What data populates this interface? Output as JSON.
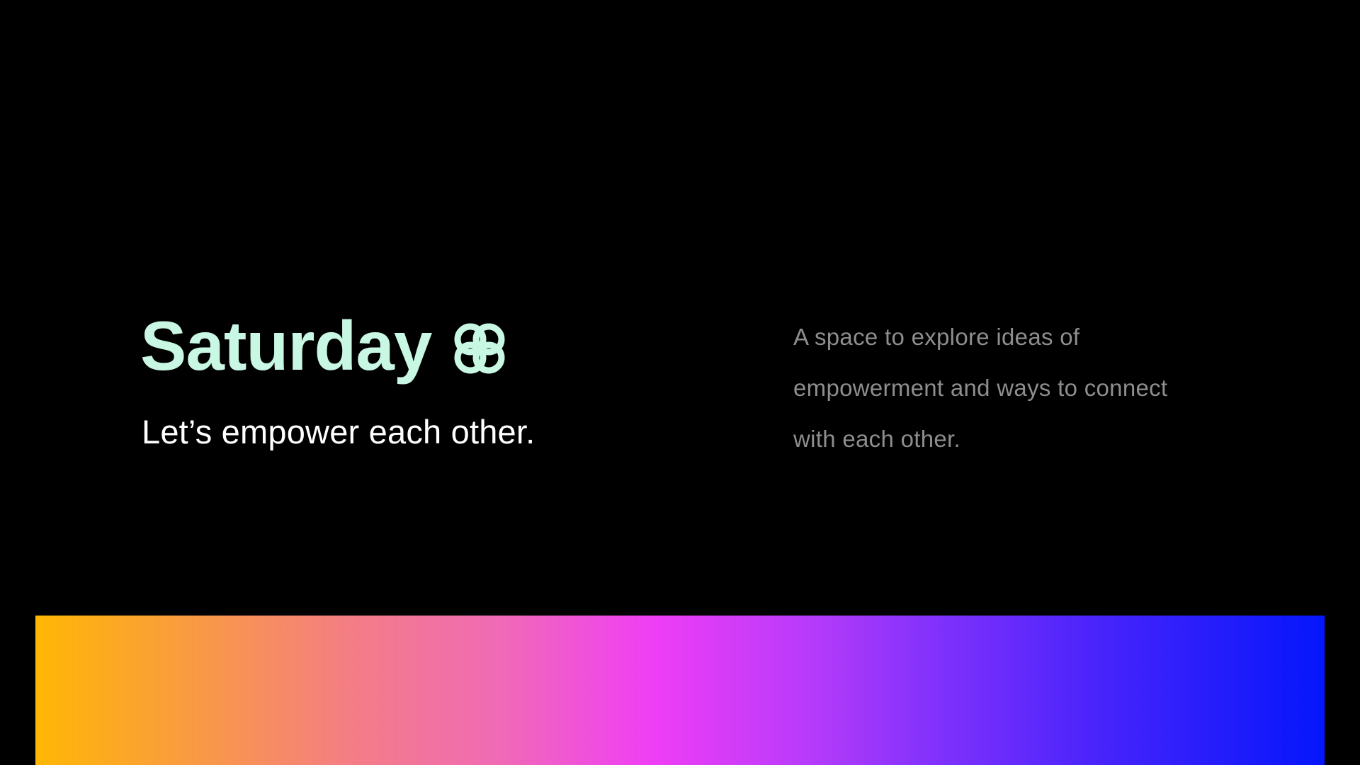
{
  "brand": {
    "title": "Saturday",
    "logo_icon": "interlocking-rings-icon",
    "title_color": "#c8f7e4"
  },
  "tagline": "Let’s empower each other.",
  "description": {
    "lines": [
      "A space to explore ideas of",
      "empowerment and ways to connect",
      "with each other."
    ]
  },
  "colors": {
    "background": "#000000",
    "tagline": "#ffffff",
    "description": "#8e8e8e",
    "gradient_stops": [
      "#ffb704",
      "#ef3df6",
      "#0416fb"
    ]
  }
}
